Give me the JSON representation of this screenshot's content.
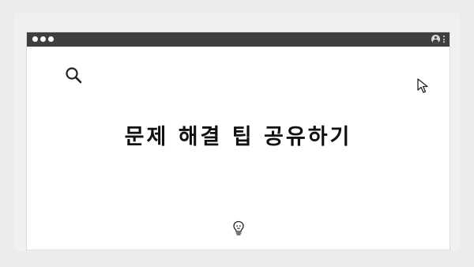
{
  "page": {
    "headline": "문제 해결 팁 공유하기"
  },
  "icons": {
    "top_pager": "pager-dots",
    "window_controls": "traffic-light-dots",
    "titlebar_account": "user-account-icon",
    "titlebar_menu": "kebab-menu-icon",
    "search": "search-icon",
    "cursor": "mouse-pointer-icon",
    "idea": "lightbulb-icon"
  },
  "colors": {
    "background": "#ececec",
    "titlebar": "#3f3f3f",
    "content_bg": "#ffffff",
    "headline": "#111111"
  }
}
